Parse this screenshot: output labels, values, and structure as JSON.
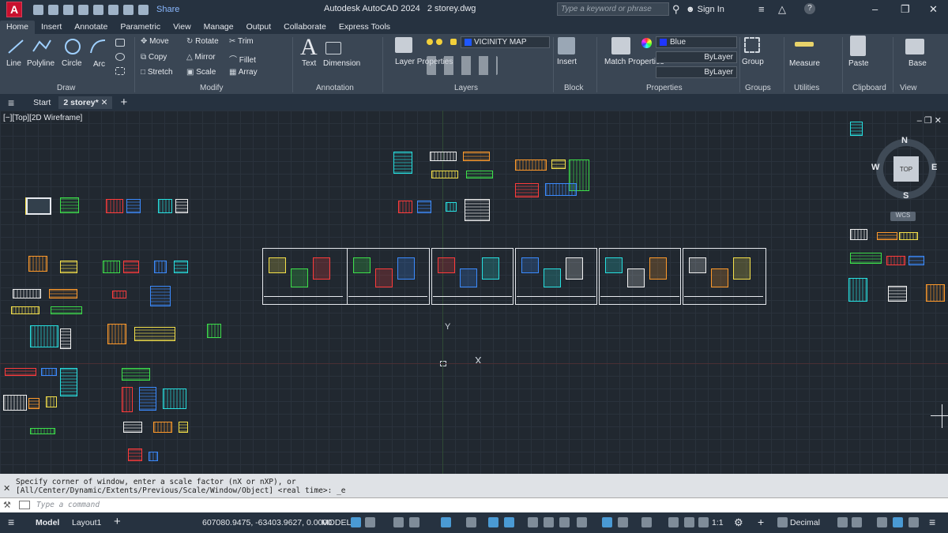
{
  "app": {
    "logo": "A",
    "share": "Share",
    "title": "Autodesk AutoCAD 2024",
    "file": "2 storey.dwg",
    "search_placeholder": "Type a keyword or phrase",
    "sign_in": "Sign In"
  },
  "tabs": [
    "Home",
    "Insert",
    "Annotate",
    "Parametric",
    "View",
    "Manage",
    "Output",
    "Collaborate",
    "Express Tools"
  ],
  "ribbon": {
    "draw": {
      "line": "Line",
      "polyline": "Polyline",
      "circle": "Circle",
      "arc": "Arc",
      "label": "Draw"
    },
    "modify": {
      "move": "Move",
      "rotate": "Rotate",
      "trim": "Trim",
      "copy": "Copy",
      "mirror": "Mirror",
      "fillet": "Fillet",
      "stretch": "Stretch",
      "scale": "Scale",
      "array": "Array",
      "label": "Modify"
    },
    "annotation": {
      "text": "Text",
      "dimension": "Dimension",
      "label": "Annotation"
    },
    "layers": {
      "layer_properties": "Layer Properties",
      "current_layer": "VICINITY MAP",
      "label": "Layers"
    },
    "block": {
      "insert": "Insert",
      "label": "Block"
    },
    "properties": {
      "match": "Match Properties",
      "color": "Blue",
      "linetype": "ByLayer",
      "lineweight": "ByLayer",
      "label": "Properties"
    },
    "groups": {
      "group": "Group",
      "label": "Groups"
    },
    "utilities": {
      "measure": "Measure",
      "label": "Utilities"
    },
    "clipboard": {
      "paste": "Paste",
      "label": "Clipboard"
    },
    "view": {
      "base": "Base",
      "label": "View"
    }
  },
  "doc_tabs": {
    "start": "Start",
    "current": "2 storey*"
  },
  "viewport": {
    "label": "[−][Top][2D Wireframe]",
    "compass": {
      "n": "N",
      "s": "S",
      "e": "E",
      "w": "W",
      "top": "TOP"
    },
    "wcs": "WCS",
    "ucs_x": "X",
    "ucs_y": "Y"
  },
  "command": {
    "line1": "Specify corner of window, enter a scale factor (nX or nXP), or",
    "line2": "[All/Center/Dynamic/Extents/Previous/Scale/Window/Object] <real time>: _e",
    "placeholder": "Type a command"
  },
  "status": {
    "model": "Model",
    "layout": "Layout1",
    "coords": "607080.9475, -63403.9627, 0.0000",
    "space": "MODEL",
    "scale": "1:1",
    "units": "Decimal"
  }
}
